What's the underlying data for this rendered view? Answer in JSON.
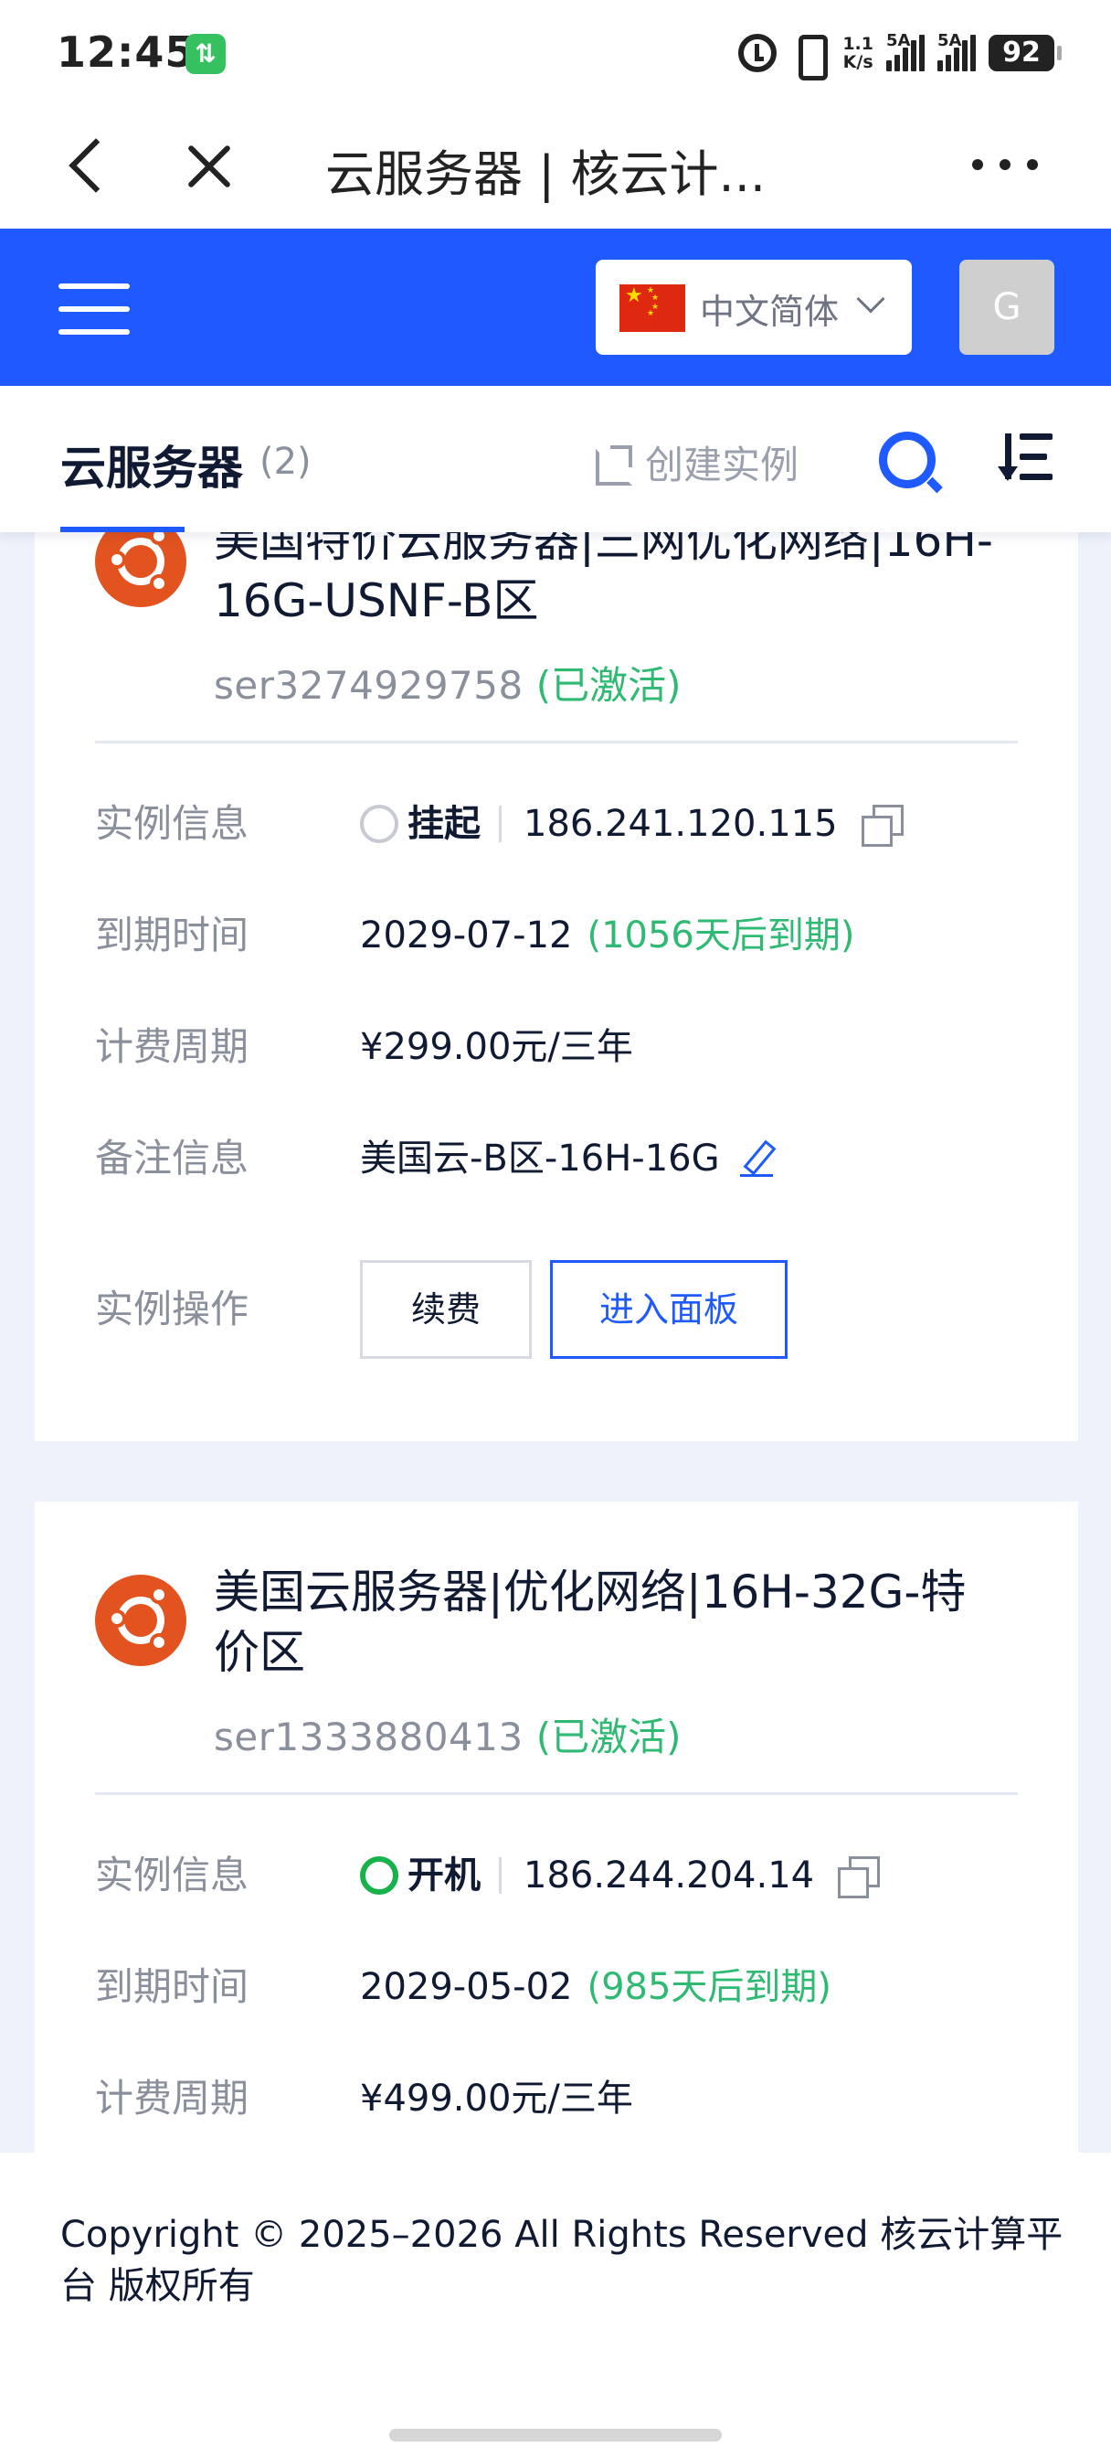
{
  "status_bar": {
    "time": "12:45",
    "speed_top": "1.1",
    "speed_bottom": "K/s",
    "sim1_label": "5A",
    "sim2_label": "5A",
    "battery": "92"
  },
  "browser": {
    "title": "云服务器 | 核云计..."
  },
  "header": {
    "language": "中文简体",
    "avatar_letter": "G",
    "accent_color": "#1e5aff"
  },
  "tabs": {
    "title": "云服务器",
    "count": "(2)",
    "create_label": "创建实例"
  },
  "servers": [
    {
      "name": "美国特价云服务器|三网优化网络|16H-16G-USNF-B区",
      "id": "ser3274929758",
      "activation": "(已激活)",
      "info_label": "实例信息",
      "state": "挂起",
      "ip": "186.241.120.115",
      "expire_label": "到期时间",
      "expire_date": "2029-07-12",
      "expire_note": "(1056天后到期)",
      "billing_label": "计费周期",
      "billing": "¥299.00元/三年",
      "remark_label": "备注信息",
      "remark": "美国云-B区-16H-16G",
      "ops_label": "实例操作",
      "renew_label": "续费",
      "panel_label": "进入面板"
    },
    {
      "name": "美国云服务器|优化网络|16H-32G-特价区",
      "id": "ser1333880413",
      "activation": "(已激活)",
      "info_label": "实例信息",
      "state": "开机",
      "ip": "186.244.204.14",
      "expire_label": "到期时间",
      "expire_date": "2029-05-02",
      "expire_note": "(985天后到期)",
      "billing_label": "计费周期",
      "billing": "¥499.00元/三年"
    }
  ],
  "footer": {
    "copyright": "Copyright © 2025–2026 All Rights Reserved 核云计算平台 版权所有"
  }
}
